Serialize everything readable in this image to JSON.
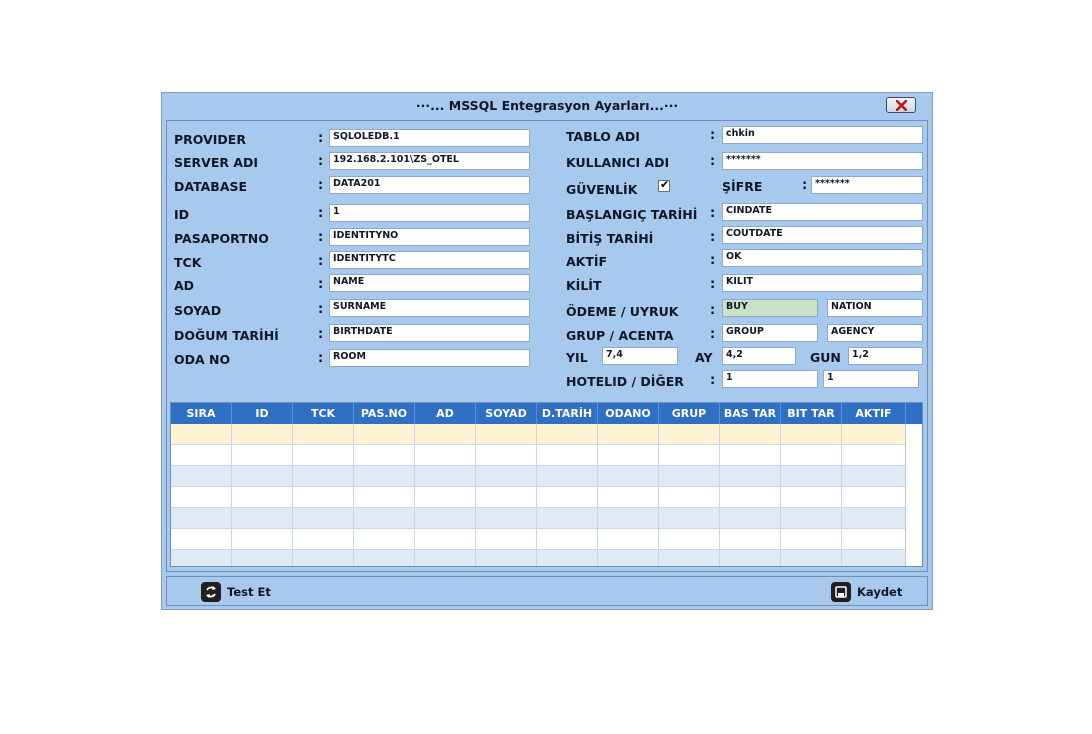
{
  "window": {
    "title": "···... MSSQL Entegrasyon Ayarları...···",
    "close_icon": "close-icon"
  },
  "left_fields": [
    {
      "label": "PROVIDER",
      "value": "SQLOLEDB.1"
    },
    {
      "label": "SERVER ADI",
      "value": "192.168.2.101\\ZS_OTEL"
    },
    {
      "label": "DATABASE",
      "value": "DATA201"
    },
    {
      "label": "ID",
      "value": "1"
    },
    {
      "label": "PASAPORTNO",
      "value": "IDENTITYNO"
    },
    {
      "label": "TCK",
      "value": "IDENTITYTC"
    },
    {
      "label": "AD",
      "value": "NAME"
    },
    {
      "label": "SOYAD",
      "value": "SURNAME"
    },
    {
      "label": "DOĞUM TARİHİ",
      "value": "BIRTHDATE"
    },
    {
      "label": "ODA NO",
      "value": "ROOM"
    }
  ],
  "right_fields": {
    "tablo_adi": {
      "label": "TABLO ADI",
      "value": "chkin"
    },
    "kullanici_adi": {
      "label": "KULLANICI ADI",
      "value": "*******"
    },
    "guvenlik": {
      "label": "GÜVENLİK",
      "checked": true,
      "check_mark": "✔"
    },
    "sifre": {
      "label": "ŞİFRE",
      "value": "*******"
    },
    "baslangic": {
      "label": "BAŞLANGIÇ TARİHİ",
      "value": "CINDATE"
    },
    "bitis": {
      "label": "BİTİŞ TARİHİ",
      "value": "COUTDATE"
    },
    "aktif": {
      "label": "AKTİF",
      "value": "OK"
    },
    "kilit": {
      "label": "KİLİT",
      "value": "KILIT"
    },
    "odeme_uyruk": {
      "label": "ÖDEME / UYRUK",
      "value1": "BUY",
      "value2": "NATION"
    },
    "grup_acenta": {
      "label": "GRUP / ACENTA",
      "value1": "GROUP",
      "value2": "AGENCY"
    },
    "yil": {
      "label": "YIL",
      "value": "7,4"
    },
    "ay": {
      "label": "AY",
      "value": "4,2"
    },
    "gun": {
      "label": "GUN",
      "value": "1,2"
    },
    "hotelid_diger": {
      "label": "HOTELID / DİĞER",
      "value1": "1",
      "value2": "1"
    }
  },
  "colon": ":",
  "grid": {
    "columns": [
      "SIRA",
      "ID",
      "TCK",
      "PAS.NO",
      "AD",
      "SOYAD",
      "D.TARİH",
      "ODANO",
      "GRUP",
      "BAS TAR",
      "BIT TAR",
      "AKTIF"
    ]
  },
  "buttons": {
    "test": {
      "label": "Test Et",
      "icon": "refresh-icon"
    },
    "save": {
      "label": "Kaydet",
      "icon": "save-icon"
    }
  }
}
